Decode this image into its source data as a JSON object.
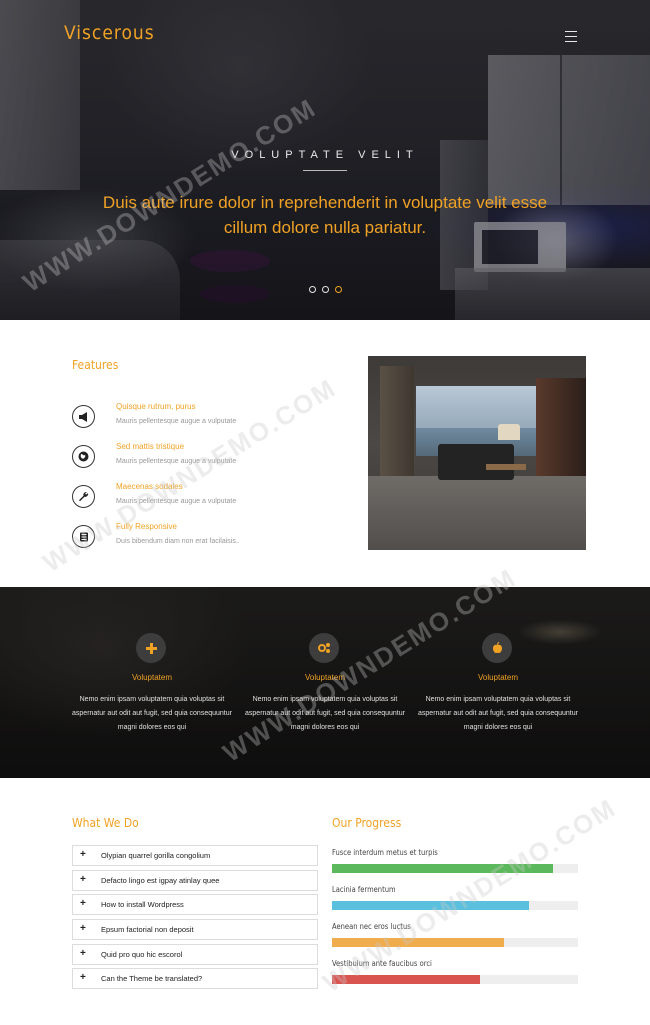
{
  "header": {
    "logo": "Viscerous",
    "menu_icon": "hamburger-menu-icon"
  },
  "hero": {
    "eyebrow": "VOLUPTATE VELIT",
    "title": "Duis aute irure dolor in reprehenderit in voluptate velit esse cillum dolore nulla pariatur.",
    "slides": 3,
    "active_slide": 3,
    "accent_color": "#f0a224"
  },
  "features": {
    "title": "Features",
    "items": [
      {
        "icon": "megaphone-icon",
        "heading": "Quisque rutrum, purus",
        "text": "Mauris pellentesque augue a vulputate"
      },
      {
        "icon": "globe-icon",
        "heading": "Sed mattis tristique",
        "text": "Mauris pellentesque augue a vulputate"
      },
      {
        "icon": "wrench-icon",
        "heading": "Maecenas sodales",
        "text": "Mauris pellentesque augue a vulputate"
      },
      {
        "icon": "responsive-icon",
        "heading": "Fully Responsive",
        "text": "Duis bibendum diam non erat facilaisis.."
      }
    ],
    "image": "living-room-photo"
  },
  "services": {
    "items": [
      {
        "icon": "plus-icon",
        "title": "Voluptatem",
        "text": "Nemo enim ipsam voluptatem quia voluptas sit aspernatur aut odit aut fugit, sed quia consequuntur magni dolores eos qui"
      },
      {
        "icon": "cog-icon",
        "title": "Voluptatem",
        "text": "Nemo enim ipsam voluptatem quia voluptas sit aspernatur aut odit aut fugit, sed quia consequuntur magni dolores eos qui"
      },
      {
        "icon": "apple-icon",
        "title": "Voluptatem",
        "text": "Nemo enim ipsam voluptatem quia voluptas sit aspernatur aut odit aut fugit, sed quia consequuntur magni dolores eos qui"
      }
    ]
  },
  "what_we_do": {
    "title": "What We Do",
    "items": [
      "Olypian quarrel gorilla congolium",
      "Defacto lingo est igpay atinlay quee",
      "How to install Wordpress",
      "Epsum factorial non deposit",
      "Quid pro quo hic escorol",
      "Can the Theme be translated?"
    ]
  },
  "progress": {
    "title": "Our Progress",
    "bars": [
      {
        "label": "Fusce interdum metus et turpis",
        "percent": 90,
        "color": "#5cb85c"
      },
      {
        "label": "Lacinia fermentum",
        "percent": 80,
        "color": "#5bc0de"
      },
      {
        "label": "Aenean nec eros luctus",
        "percent": 70,
        "color": "#f0ad4e"
      },
      {
        "label": "Vestibulum ante faucibus orci",
        "percent": 60,
        "color": "#d9534f"
      }
    ]
  },
  "watermark": "WWW.DOWNDEMO.COM"
}
